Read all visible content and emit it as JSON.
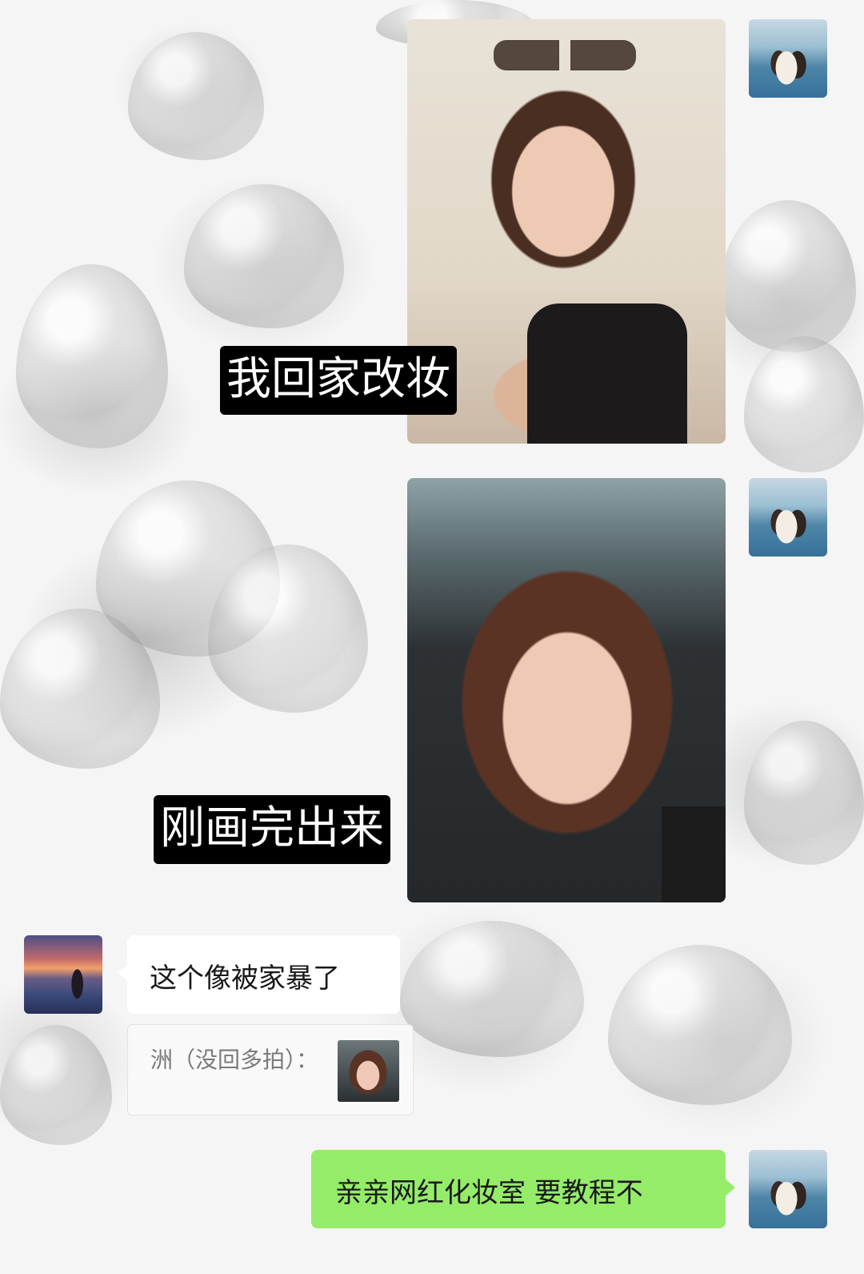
{
  "messages": [
    {
      "type": "image",
      "side": "right",
      "caption": "我回家改妆"
    },
    {
      "type": "image",
      "side": "right",
      "caption": "刚画完出来"
    },
    {
      "type": "text",
      "side": "left",
      "text": "这个像被家暴了"
    },
    {
      "type": "quote",
      "side": "left",
      "text": "洲（没回多拍）："
    },
    {
      "type": "text",
      "side": "right",
      "text": "亲亲网红化妆室 要教程不"
    }
  ],
  "colors": {
    "own_bubble": "#95ec69",
    "other_bubble": "#ffffff",
    "caption_bg": "#000000"
  },
  "icons": [
    "avatar-couple",
    "avatar-sunset"
  ]
}
